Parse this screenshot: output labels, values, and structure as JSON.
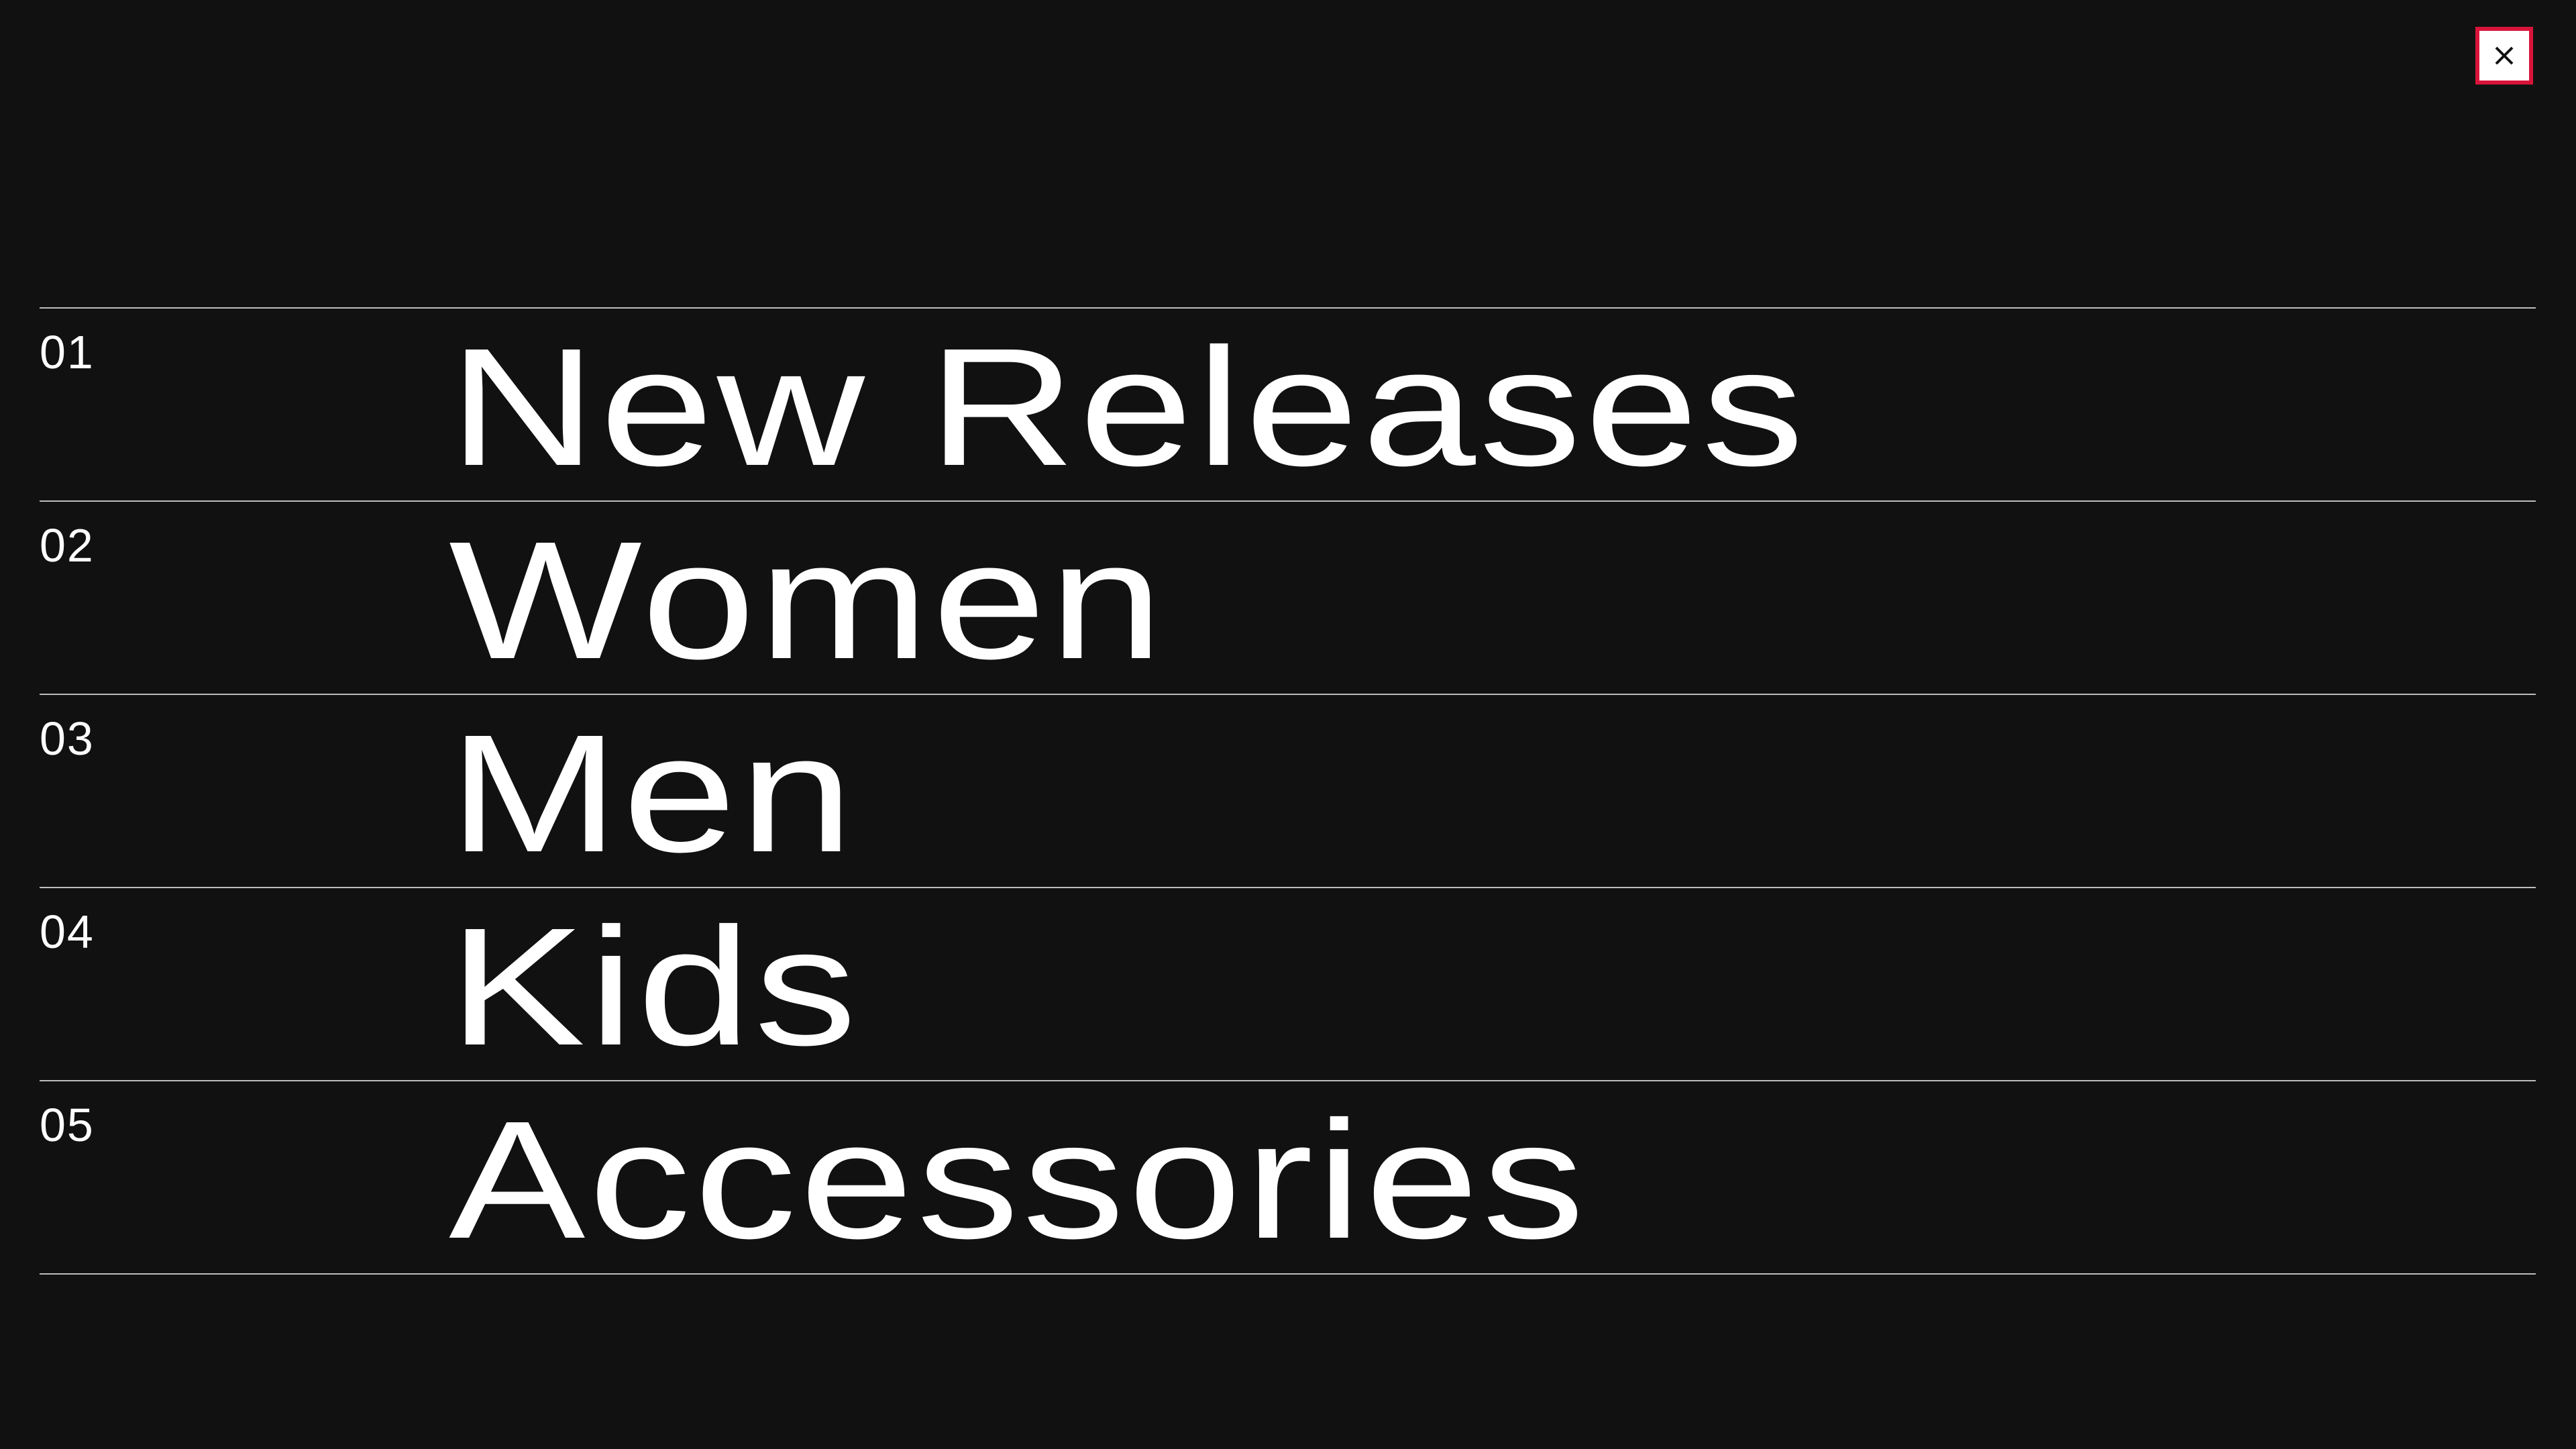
{
  "close_button": {
    "icon": "close-icon",
    "label": "×",
    "border_color": "#d9143a"
  },
  "menu": {
    "items": [
      {
        "number": "01",
        "label": "New Releases"
      },
      {
        "number": "02",
        "label": "Women"
      },
      {
        "number": "03",
        "label": "Men"
      },
      {
        "number": "04",
        "label": "Kids"
      },
      {
        "number": "05",
        "label": "Accessories"
      }
    ]
  },
  "colors": {
    "background": "#111111",
    "text": "#ffffff",
    "divider": "#bdbdbd",
    "accent": "#d9143a"
  }
}
